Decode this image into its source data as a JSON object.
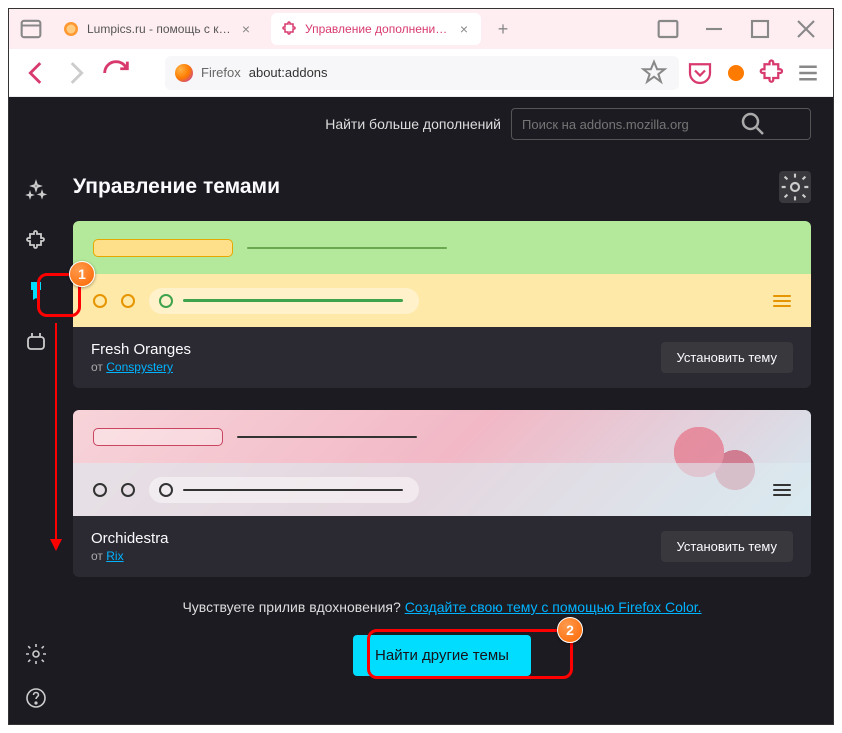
{
  "tabs": [
    {
      "label": "Lumpics.ru - помощь с компь",
      "favicon_color": "#ff9933"
    },
    {
      "label": "Управление дополнениями"
    }
  ],
  "urlbar": {
    "fx_label": "Firefox",
    "address": "about:addons"
  },
  "search": {
    "label": "Найти больше дополнений",
    "placeholder": "Поиск на addons.mozilla.org"
  },
  "page": {
    "title": "Управление темами",
    "themes": [
      {
        "name": "Fresh Oranges",
        "author_prefix": "от ",
        "author": "Conspystery",
        "install": "Установить тему"
      },
      {
        "name": "Orchidestra",
        "author_prefix": "от ",
        "author": "Rix",
        "install": "Установить тему"
      }
    ],
    "inspiration_text": "Чувствуете прилив вдохновения? ",
    "inspiration_link": "Создайте свою тему с помощью Firefox Color.",
    "find_more": "Найти другие темы"
  },
  "annotations": {
    "badge1": "1",
    "badge2": "2"
  }
}
